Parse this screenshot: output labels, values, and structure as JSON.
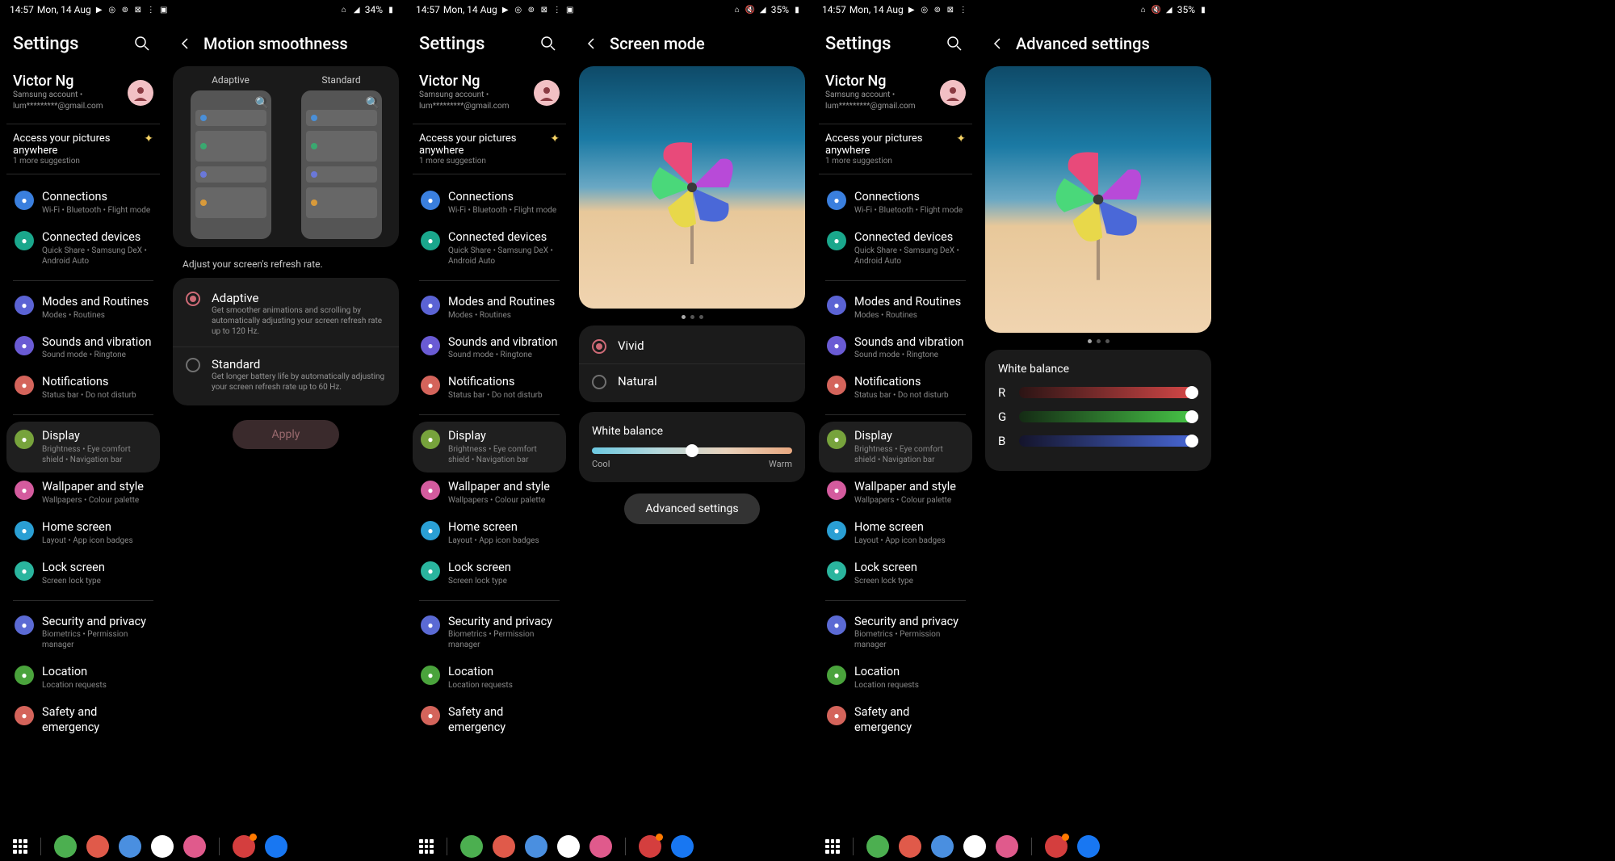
{
  "status": {
    "time": "14:57",
    "date": "Mon, 14 Aug",
    "battery1": "34%",
    "battery2": "35%",
    "battery3": "35%"
  },
  "sidebar": {
    "title": "Settings",
    "account": {
      "name": "Victor Ng",
      "sub1": "Samsung account •",
      "sub2": "lum*********@gmail.com"
    },
    "promo": {
      "title": "Access your pictures anywhere",
      "sub": "1 more suggestion"
    },
    "cats": [
      {
        "t": "Connections",
        "s": "Wi-Fi • Bluetooth • Flight mode",
        "c": "#3a7fde",
        "icon": "wifi"
      },
      {
        "t": "Connected devices",
        "s": "Quick Share • Samsung DeX • Android Auto",
        "c": "#1aa78c",
        "icon": "devices"
      },
      {
        "t": "Modes and Routines",
        "s": "Modes • Routines",
        "c": "#5b63d4",
        "icon": "circle"
      },
      {
        "t": "Sounds and vibration",
        "s": "Sound mode • Ringtone",
        "c": "#6a5bd4",
        "icon": "sound"
      },
      {
        "t": "Notifications",
        "s": "Status bar • Do not disturb",
        "c": "#d4645b",
        "icon": "bell"
      },
      {
        "t": "Display",
        "s": "Brightness • Eye comfort shield • Navigation bar",
        "c": "#77a33c",
        "icon": "sun"
      },
      {
        "t": "Wallpaper and style",
        "s": "Wallpapers • Colour palette",
        "c": "#d45b9e",
        "icon": "palette"
      },
      {
        "t": "Home screen",
        "s": "Layout • App icon badges",
        "c": "#2a9fd4",
        "icon": "home"
      },
      {
        "t": "Lock screen",
        "s": "Screen lock type",
        "c": "#2ab59e",
        "icon": "lock"
      },
      {
        "t": "Security and privacy",
        "s": "Biometrics • Permission manager",
        "c": "#5b6ad4",
        "icon": "shield"
      },
      {
        "t": "Location",
        "s": "Location requests",
        "c": "#4aa33c",
        "icon": "pin"
      },
      {
        "t": "Safety and emergency",
        "s": "",
        "c": "#d4645b",
        "icon": "alert"
      }
    ],
    "dividers_after": [
      1,
      4,
      8
    ]
  },
  "motion": {
    "title": "Motion smoothness",
    "preview_a": "Adaptive",
    "preview_b": "Standard",
    "desc": "Adjust your screen's refresh rate.",
    "opts": [
      {
        "t": "Adaptive",
        "s": "Get smoother animations and scrolling by automatically adjusting your screen refresh rate up to 120 Hz.",
        "checked": true
      },
      {
        "t": "Standard",
        "s": "Get longer battery life by automatically adjusting your screen refresh rate up to 60 Hz.",
        "checked": false
      }
    ],
    "apply": "Apply"
  },
  "screenmode": {
    "title": "Screen mode",
    "opts": [
      {
        "t": "Vivid",
        "checked": true
      },
      {
        "t": "Natural",
        "checked": false
      }
    ],
    "wb": {
      "title": "White balance",
      "cool": "Cool",
      "warm": "Warm"
    },
    "adv": "Advanced settings"
  },
  "advanced": {
    "title": "Advanced settings",
    "wb_title": "White balance",
    "rgb": [
      {
        "l": "R",
        "g": "linear-gradient(90deg,#2b1414,#d84848)"
      },
      {
        "l": "G",
        "g": "linear-gradient(90deg,#142b14,#48c848)"
      },
      {
        "l": "B",
        "g": "linear-gradient(90deg,#14142b,#4868d8)"
      }
    ]
  },
  "dock": [
    {
      "n": "phone",
      "c": "#4caf50"
    },
    {
      "n": "music",
      "c": "#e05a4a"
    },
    {
      "n": "gmaps",
      "c": "#4a8fe0"
    },
    {
      "n": "chrome",
      "c": "#fff"
    },
    {
      "n": "camera",
      "c": "#e05a8c"
    },
    {
      "n": "youtube",
      "c": "#d43e3e",
      "badge": true
    },
    {
      "n": "facebook",
      "c": "#1877f2"
    }
  ]
}
